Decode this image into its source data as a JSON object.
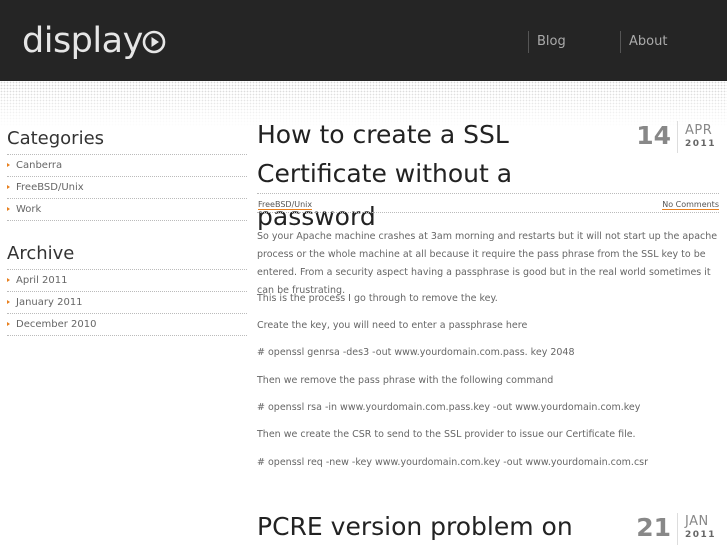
{
  "header": {
    "logo_text": "display",
    "nav": [
      {
        "label": "Blog"
      },
      {
        "label": "About"
      }
    ]
  },
  "sidebar": {
    "categories_title": "Categories",
    "categories": [
      {
        "label": "Canberra"
      },
      {
        "label": "FreeBSD/Unix"
      },
      {
        "label": "Work"
      }
    ],
    "archive_title": "Archive",
    "archive": [
      {
        "label": "April 2011"
      },
      {
        "label": "January 2011"
      },
      {
        "label": "December 2010"
      }
    ]
  },
  "posts": [
    {
      "title_line1": "How to create a SSL",
      "title_line2": "Certificate without a password",
      "day": "14",
      "month": "APR",
      "year": "2011",
      "category": "FreeBSD/Unix",
      "comments": "No Comments",
      "body": [
        "So your Apache machine crashes at 3am morning and restarts but it will not start up the apache process or the whole machine at all because it require the pass phrase from the SSL key to be entered. From a security aspect having a passphrase is good but in the real world sometimes it can be frustrating.",
        "This is the process I go through to remove the key.",
        "Create the key, you will need to enter a passphrase here",
        "# openssl genrsa -des3 -out www.yourdomain.com.pass. key 2048",
        "Then we remove the pass phrase with the following command",
        "# openssl rsa -in www.yourdomain.com.pass.key -out www.yourdomain.com.key",
        "Then we create the CSR to send to the SSL provider to issue our Certificate file.",
        "# openssl req -new -key www.yourdomain.com.key -out www.yourdomain.com.csr"
      ]
    },
    {
      "title_line1": "PCRE version problem on",
      "day": "21",
      "month": "JAN",
      "year": "2011"
    }
  ]
}
